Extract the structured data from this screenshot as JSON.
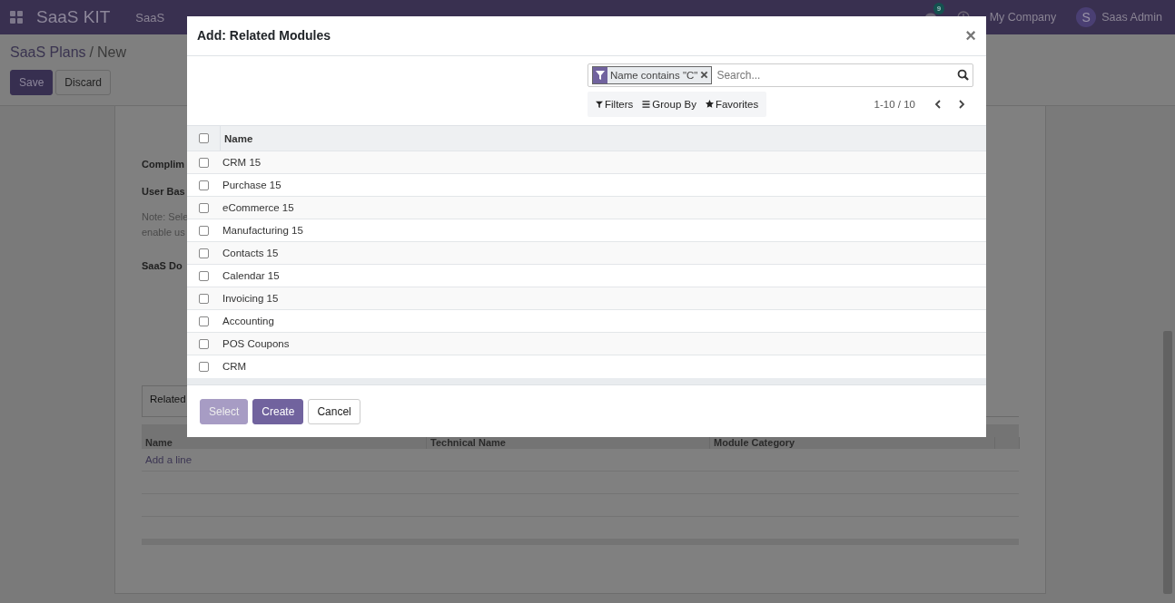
{
  "navbar": {
    "app_name": "SaaS KIT",
    "menus": [
      "SaaS"
    ],
    "notification_count": "9",
    "company": "My Company",
    "user": {
      "initial": "S",
      "name": "Saas Admin"
    }
  },
  "breadcrumb": {
    "parent": "SaaS Plans",
    "separator": "/",
    "current": "New"
  },
  "actions": [
    {
      "label": "Save",
      "kind": "primary"
    },
    {
      "label": "Discard",
      "kind": "secondary"
    }
  ],
  "form": {
    "labels": [
      "Complim",
      "User Bas"
    ],
    "note_lines": [
      "Note: Sele",
      "enable us"
    ],
    "section_label": "SaaS Do",
    "tab": "Related",
    "columns": [
      "Name",
      "Technical Name",
      "Module Category"
    ],
    "add_line": "Add a line"
  },
  "dialog": {
    "title": "Add: Related Modules",
    "close": "×",
    "facet": "Name contains \"C\"",
    "search_placeholder": "Search...",
    "filters": [
      "Filters",
      "Group By",
      "Favorites"
    ],
    "pager": "1-10 / 10",
    "column": "Name",
    "all_selected": false,
    "rows": [
      {
        "name": "CRM 15",
        "selected": false
      },
      {
        "name": "Purchase 15",
        "selected": false
      },
      {
        "name": "eCommerce 15",
        "selected": false
      },
      {
        "name": "Manufacturing 15",
        "selected": false
      },
      {
        "name": "Contacts 15",
        "selected": false
      },
      {
        "name": "Calendar 15",
        "selected": false
      },
      {
        "name": "Invoicing 15",
        "selected": false
      },
      {
        "name": "Accounting",
        "selected": false
      },
      {
        "name": "POS Coupons",
        "selected": false
      },
      {
        "name": "CRM",
        "selected": false
      }
    ],
    "buttons": [
      {
        "label": "Select",
        "kind": "primary",
        "disabled": true
      },
      {
        "label": "Create",
        "kind": "primary",
        "disabled": false
      },
      {
        "label": "Cancel",
        "kind": "secondary",
        "disabled": false
      }
    ]
  }
}
